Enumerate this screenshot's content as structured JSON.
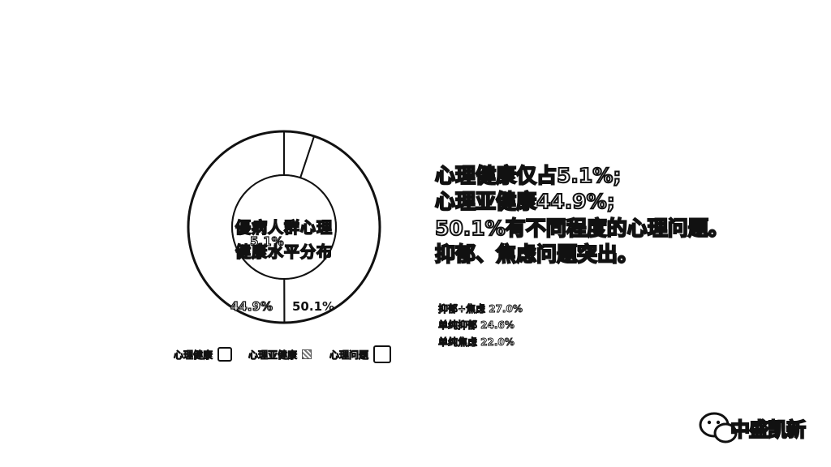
{
  "chart_data": {
    "type": "pie",
    "categories": [
      "心理健康",
      "心理亚健康",
      "心理问题"
    ],
    "values": [
      5.1,
      44.9,
      50.1
    ],
    "value_labels": [
      "5.1%",
      "44.9%",
      "50.1%"
    ],
    "center_title_lines": [
      "優病人群心理",
      "健康水平分布"
    ]
  },
  "headline": {
    "lines": [
      "心理健康仅占5.1%;",
      "心理亚健康44.9%;",
      "50.1%有不同程度的心理问题。",
      "抑郁、焦虑问题突出。"
    ]
  },
  "breakdown": {
    "lines": [
      "抑郁+焦虑 27.0%",
      "单纯抑郁 24.6%",
      "单纯焦虑 22.0%"
    ]
  },
  "logo": {
    "text": "中盛凯新"
  },
  "colors": {
    "ink": "#111111",
    "background": "#ffffff"
  }
}
